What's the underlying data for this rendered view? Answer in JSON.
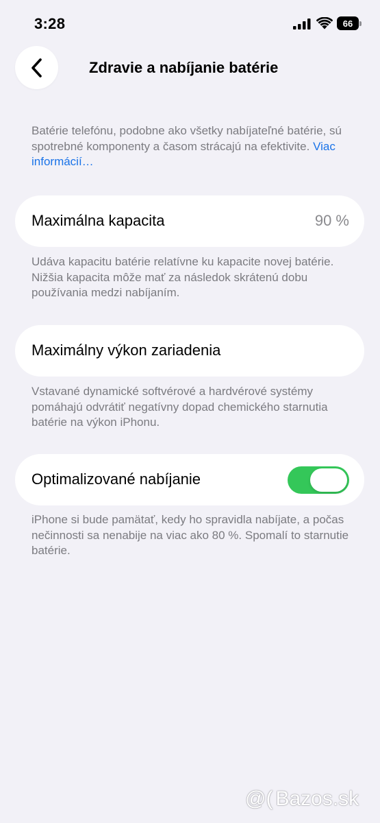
{
  "status_bar": {
    "time": "3:28",
    "battery_level": "66",
    "icons": [
      "signal-icon",
      "wifi-icon",
      "battery-icon"
    ]
  },
  "nav": {
    "back_icon": "chevron-left-icon",
    "title": "Zdravie a nabíjanie batérie"
  },
  "intro": {
    "text": "Batérie telefónu, podobne ako všetky nabíjateľné batérie, sú spotrebné komponenty a časom strácajú na efektivite.",
    "link": "Viac informácií…"
  },
  "max_capacity": {
    "label": "Maximálna kapacita",
    "value": "90 %",
    "footnote": "Udáva kapacitu batérie relatívne ku kapacite novej batérie. Nižšia kapacita môže mať za následok skrátenú dobu používania medzi nabíjaním."
  },
  "peak_performance": {
    "label": "Maximálny výkon zariadenia",
    "footnote": "Vstavané dynamické softvérové a hardvérové systémy pomáhajú odvrátiť negatívny dopad chemického starnutia batérie na výkon iPhonu."
  },
  "optimized_charging": {
    "label": "Optimalizované nabíjanie",
    "enabled": true,
    "footnote": "iPhone si bude pamätať, kedy ho spravidla nabíjate, a počas nečinnosti sa nenabije na viac ako 80 %. Spomalí to starnutie batérie."
  },
  "watermark": {
    "text": "Bazos.sk"
  },
  "colors": {
    "background": "#f2f1f7",
    "toggle_on": "#34c759",
    "link": "#1a73e8",
    "secondary_text": "#7b7b80"
  }
}
